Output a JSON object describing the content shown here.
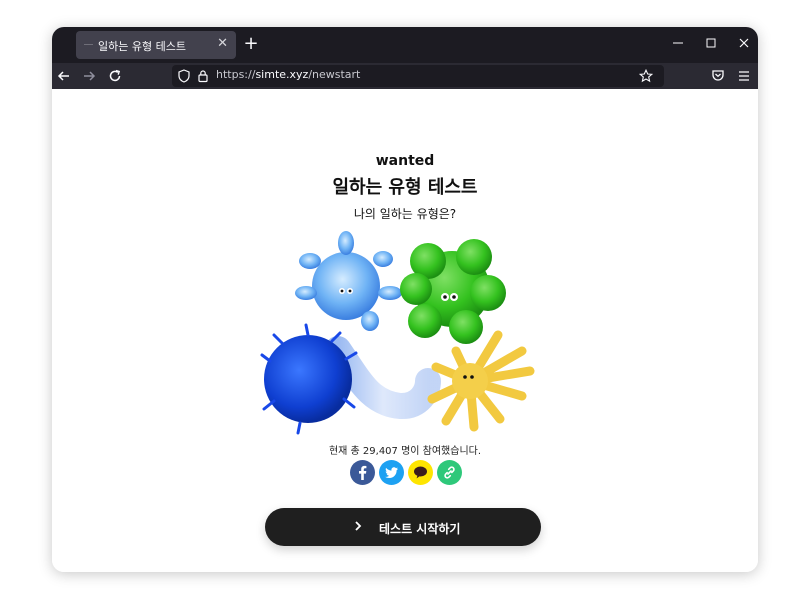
{
  "browser": {
    "tab_title": "일하는 유형 테스트",
    "url_scheme": "https://",
    "url_host": "simte.xyz",
    "url_path": "/newstart"
  },
  "page": {
    "brand": "wanted",
    "title": "일하는 유형 테스트",
    "subtitle": "나의 일하는 유형은?",
    "participants": "현재 총 29,407 명이 참여했습니다.",
    "start_button": "테스트 시작하기"
  },
  "share": [
    {
      "name": "facebook",
      "icon": "facebook-icon",
      "color": "#3b5998"
    },
    {
      "name": "twitter",
      "icon": "twitter-icon",
      "color": "#1da1f2"
    },
    {
      "name": "kakaotalk",
      "icon": "kakaotalk-icon",
      "color": "#fee500"
    },
    {
      "name": "copy-link",
      "icon": "link-icon",
      "color": "#2ec87a"
    }
  ],
  "colors": {
    "titlebar": "#1c1b22",
    "toolbar": "#2b2a33",
    "start_button": "#1f1f1f"
  }
}
